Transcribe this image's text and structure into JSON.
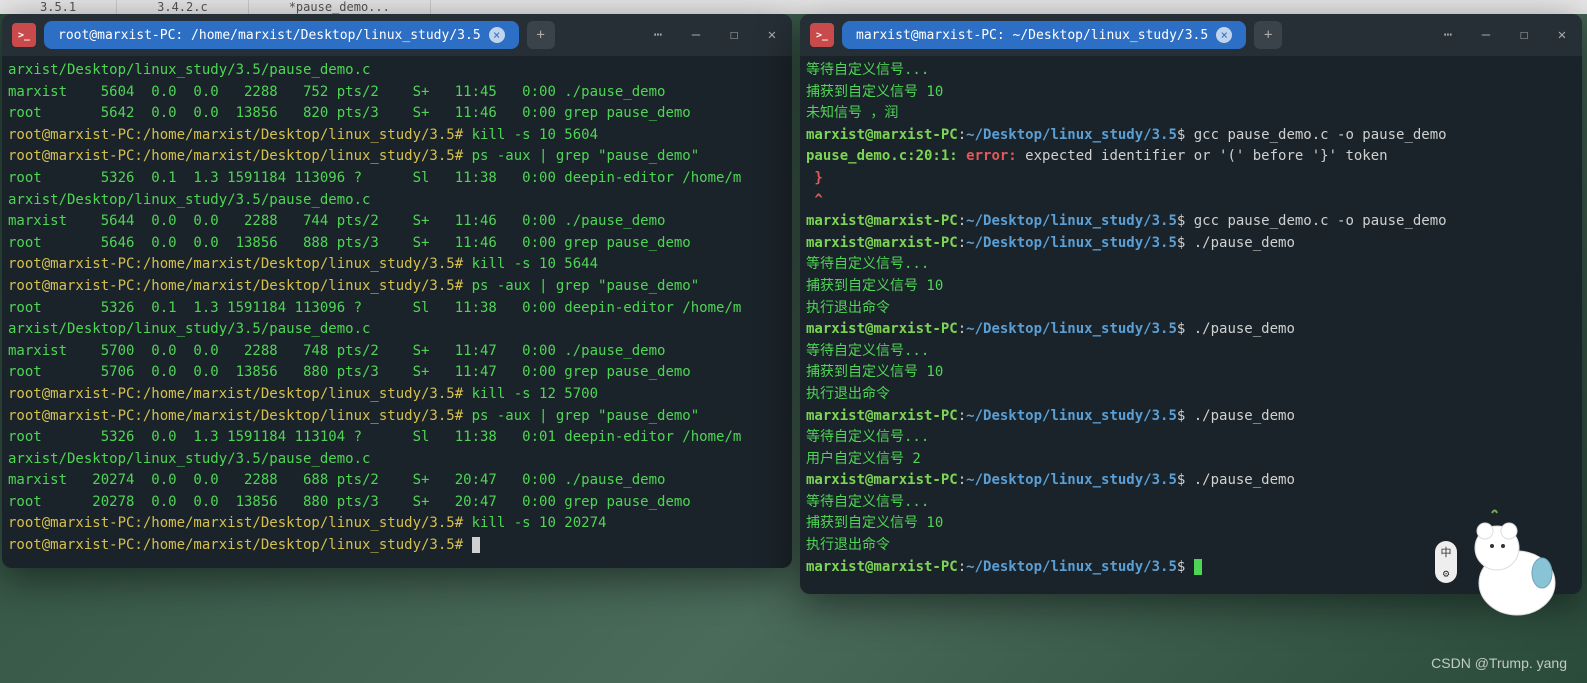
{
  "bg_tabs": [
    "3.5.1",
    "3.4.2.c",
    "*pause_demo..."
  ],
  "left": {
    "title": "root@marxist-PC: /home/marxist/Desktop/linux_study/3.5",
    "lines": [
      {
        "cls": "green",
        "text": "arxist/Desktop/linux_study/3.5/pause_demo.c"
      },
      {
        "cls": "green",
        "text": "marxist    5604  0.0  0.0   2288   752 pts/2    S+   11:45   0:00 ./pause_demo"
      },
      {
        "cls": "green",
        "text": "root       5642  0.0  0.0  13856   820 pts/3    S+   11:46   0:00 grep pause_demo"
      },
      {
        "segs": [
          {
            "cls": "yellow",
            "text": "root@marxist-PC:/home/marxist/Desktop/linux_study/3.5#"
          },
          {
            "cls": "green",
            "text": " kill -s 10 5604"
          }
        ]
      },
      {
        "segs": [
          {
            "cls": "yellow",
            "text": "root@marxist-PC:/home/marxist/Desktop/linux_study/3.5#"
          },
          {
            "cls": "green",
            "text": " ps -aux | grep \"pause_demo\""
          }
        ]
      },
      {
        "cls": "green",
        "text": "root       5326  0.1  1.3 1591184 113096 ?      Sl   11:38   0:00 deepin-editor /home/m"
      },
      {
        "cls": "green",
        "text": "arxist/Desktop/linux_study/3.5/pause_demo.c"
      },
      {
        "cls": "green",
        "text": "marxist    5644  0.0  0.0   2288   744 pts/2    S+   11:46   0:00 ./pause_demo"
      },
      {
        "cls": "green",
        "text": "root       5646  0.0  0.0  13856   888 pts/3    S+   11:46   0:00 grep pause_demo"
      },
      {
        "segs": [
          {
            "cls": "yellow",
            "text": "root@marxist-PC:/home/marxist/Desktop/linux_study/3.5#"
          },
          {
            "cls": "green",
            "text": " kill -s 10 5644"
          }
        ]
      },
      {
        "segs": [
          {
            "cls": "yellow",
            "text": "root@marxist-PC:/home/marxist/Desktop/linux_study/3.5#"
          },
          {
            "cls": "green",
            "text": " ps -aux | grep \"pause_demo\""
          }
        ]
      },
      {
        "cls": "green",
        "text": "root       5326  0.1  1.3 1591184 113096 ?      Sl   11:38   0:00 deepin-editor /home/m"
      },
      {
        "cls": "green",
        "text": "arxist/Desktop/linux_study/3.5/pause_demo.c"
      },
      {
        "cls": "green",
        "text": "marxist    5700  0.0  0.0   2288   748 pts/2    S+   11:47   0:00 ./pause_demo"
      },
      {
        "cls": "green",
        "text": "root       5706  0.0  0.0  13856   880 pts/3    S+   11:47   0:00 grep pause_demo"
      },
      {
        "segs": [
          {
            "cls": "yellow",
            "text": "root@marxist-PC:/home/marxist/Desktop/linux_study/3.5#"
          },
          {
            "cls": "green",
            "text": " kill -s 12 5700"
          }
        ]
      },
      {
        "segs": [
          {
            "cls": "yellow",
            "text": "root@marxist-PC:/home/marxist/Desktop/linux_study/3.5#"
          },
          {
            "cls": "green",
            "text": " ps -aux | grep \"pause_demo\""
          }
        ]
      },
      {
        "cls": "green",
        "text": "root       5326  0.0  1.3 1591184 113104 ?      Sl   11:38   0:01 deepin-editor /home/m"
      },
      {
        "cls": "green",
        "text": "arxist/Desktop/linux_study/3.5/pause_demo.c"
      },
      {
        "cls": "green",
        "text": "marxist   20274  0.0  0.0   2288   688 pts/2    S+   20:47   0:00 ./pause_demo"
      },
      {
        "cls": "green",
        "text": "root      20278  0.0  0.0  13856   880 pts/3    S+   20:47   0:00 grep pause_demo"
      },
      {
        "segs": [
          {
            "cls": "yellow",
            "text": "root@marxist-PC:/home/marxist/Desktop/linux_study/3.5#"
          },
          {
            "cls": "green",
            "text": " kill -s 10 20274"
          }
        ]
      },
      {
        "segs": [
          {
            "cls": "yellow",
            "text": "root@marxist-PC:/home/marxist/Desktop/linux_study/3.5#"
          },
          {
            "cls": "green",
            "text": " "
          },
          {
            "cursor": "white"
          }
        ]
      }
    ]
  },
  "right": {
    "title": "marxist@marxist-PC: ~/Desktop/linux_study/3.5",
    "lines": [
      {
        "cls": "green",
        "text": "等待自定义信号..."
      },
      {
        "cls": "green",
        "text": "捕获到自定义信号 10"
      },
      {
        "cls": "green",
        "text": "未知信号 ，润"
      },
      {
        "segs": [
          {
            "cls": "green-b",
            "text": "marxist@marxist-PC"
          },
          {
            "cls": "white",
            "text": ":"
          },
          {
            "cls": "blue-b",
            "text": "~/Desktop/linux_study/3.5"
          },
          {
            "cls": "white",
            "text": "$ gcc pause_demo.c -o pause_demo"
          }
        ]
      },
      {
        "segs": [
          {
            "cls": "green-b",
            "text": "pause_demo.c:20:1: "
          },
          {
            "cls": "red-b",
            "text": "error:"
          },
          {
            "cls": "white",
            "text": " expected identifier or '(' before '}' token"
          }
        ]
      },
      {
        "cls": "red-b",
        "text": " }"
      },
      {
        "cls": "red-b",
        "text": " ^"
      },
      {
        "segs": [
          {
            "cls": "green-b",
            "text": "marxist@marxist-PC"
          },
          {
            "cls": "white",
            "text": ":"
          },
          {
            "cls": "blue-b",
            "text": "~/Desktop/linux_study/3.5"
          },
          {
            "cls": "white",
            "text": "$ gcc pause_demo.c -o pause_demo"
          }
        ]
      },
      {
        "segs": [
          {
            "cls": "green-b",
            "text": "marxist@marxist-PC"
          },
          {
            "cls": "white",
            "text": ":"
          },
          {
            "cls": "blue-b",
            "text": "~/Desktop/linux_study/3.5"
          },
          {
            "cls": "white",
            "text": "$ ./pause_demo"
          }
        ]
      },
      {
        "cls": "green",
        "text": "等待自定义信号..."
      },
      {
        "cls": "green",
        "text": "捕获到自定义信号 10"
      },
      {
        "cls": "green",
        "text": "执行退出命令"
      },
      {
        "segs": [
          {
            "cls": "green-b",
            "text": "marxist@marxist-PC"
          },
          {
            "cls": "white",
            "text": ":"
          },
          {
            "cls": "blue-b",
            "text": "~/Desktop/linux_study/3.5"
          },
          {
            "cls": "white",
            "text": "$ ./pause_demo"
          }
        ]
      },
      {
        "cls": "green",
        "text": "等待自定义信号..."
      },
      {
        "cls": "green",
        "text": "捕获到自定义信号 10"
      },
      {
        "cls": "green",
        "text": "执行退出命令"
      },
      {
        "segs": [
          {
            "cls": "green-b",
            "text": "marxist@marxist-PC"
          },
          {
            "cls": "white",
            "text": ":"
          },
          {
            "cls": "blue-b",
            "text": "~/Desktop/linux_study/3.5"
          },
          {
            "cls": "white",
            "text": "$ ./pause_demo"
          }
        ]
      },
      {
        "cls": "green",
        "text": "等待自定义信号..."
      },
      {
        "cls": "green",
        "text": "用户自定义信号 2"
      },
      {
        "segs": [
          {
            "cls": "green-b",
            "text": "marxist@marxist-PC"
          },
          {
            "cls": "white",
            "text": ":"
          },
          {
            "cls": "blue-b",
            "text": "~/Desktop/linux_study/3.5"
          },
          {
            "cls": "white",
            "text": "$ ./pause_demo"
          }
        ]
      },
      {
        "cls": "green",
        "text": "等待自定义信号..."
      },
      {
        "cls": "green",
        "text": "捕获到自定义信号 10"
      },
      {
        "cls": "green",
        "text": "执行退出命令"
      },
      {
        "segs": [
          {
            "cls": "green-b",
            "text": "marxist@marxist-PC"
          },
          {
            "cls": "white",
            "text": ":"
          },
          {
            "cls": "blue-b",
            "text": "~/Desktop/linux_study/3.5"
          },
          {
            "cls": "white",
            "text": "$ "
          },
          {
            "cursor": "green"
          }
        ]
      }
    ]
  },
  "watermark": "CSDN @Trump. yang",
  "ime": {
    "top": "中",
    "bottom": "⚙"
  }
}
